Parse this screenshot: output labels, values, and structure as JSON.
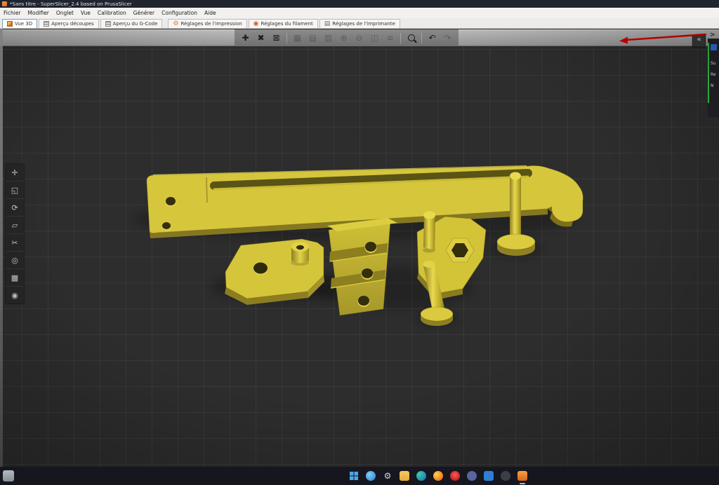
{
  "window": {
    "title": "*Sans titre - SuperSlicer_2.4 based on PrusaSlicer"
  },
  "menubar": {
    "items": [
      "Fichier",
      "Modifier",
      "Onglet",
      "Vue",
      "Calibration",
      "Générer",
      "Configuration",
      "Aide"
    ]
  },
  "tabbar": {
    "tabs": [
      {
        "label": "Vue 3D",
        "icon": "cube-icon",
        "active": true
      },
      {
        "label": "Aperçu découpes",
        "icon": "slices-icon",
        "active": false
      },
      {
        "label": "Aperçu du G-Code",
        "icon": "gcode-icon",
        "active": false
      },
      {
        "label": "Réglages de l'impression",
        "icon": "gear-icon",
        "glyph": "⚙",
        "active": false
      },
      {
        "label": "Réglages du filament",
        "icon": "filament-spool-icon",
        "glyph": "◉",
        "active": false
      },
      {
        "label": "Réglages de l'imprimante",
        "icon": "printer-icon",
        "glyph": "▤",
        "active": false
      }
    ]
  },
  "toolbar": {
    "items": [
      {
        "name": "add-object",
        "glyph": "✚",
        "enabled": true
      },
      {
        "name": "delete-object",
        "glyph": "✖",
        "enabled": true
      },
      {
        "name": "delete-all",
        "glyph": "⊠",
        "enabled": true
      },
      {
        "name": "arrange",
        "glyph": "▦",
        "enabled": false
      },
      {
        "name": "copy",
        "glyph": "▤",
        "enabled": false
      },
      {
        "name": "paste",
        "glyph": "▥",
        "enabled": false
      },
      {
        "name": "add-instance",
        "glyph": "⊕",
        "enabled": false
      },
      {
        "name": "remove-instance",
        "glyph": "⊖",
        "enabled": false
      },
      {
        "name": "split-to-objects",
        "glyph": "◫",
        "enabled": false
      },
      {
        "name": "variable-layer-height",
        "glyph": "≡",
        "enabled": false
      },
      {
        "name": "search",
        "glyph": "",
        "enabled": true
      },
      {
        "name": "undo",
        "glyph": "↶",
        "enabled": true
      },
      {
        "name": "redo",
        "glyph": "↷",
        "enabled": false
      }
    ]
  },
  "gizmo_toolbar": {
    "items": [
      {
        "name": "move",
        "glyph": "✛"
      },
      {
        "name": "scale",
        "glyph": "◱"
      },
      {
        "name": "rotate",
        "glyph": "⟳"
      },
      {
        "name": "place-on-face",
        "glyph": "▱"
      },
      {
        "name": "cut",
        "glyph": "✂"
      },
      {
        "name": "hollow-drill",
        "glyph": "◎"
      },
      {
        "name": "paint-supports",
        "glyph": "▩"
      },
      {
        "name": "seam",
        "glyph": "◉"
      }
    ]
  },
  "viewport": {
    "collapse_button_glyph": "«",
    "expand_button_glyph": ">",
    "model_color": "#d6c63c",
    "model_shadow_color": "#8f8121",
    "bed_color": "#2d2d2d",
    "grid_line_color": "#3c3c3c",
    "parts": [
      {
        "name": "long-slotted-bar"
      },
      {
        "name": "flat-plate-with-hole"
      },
      {
        "name": "stepped-bracket-three-holes"
      },
      {
        "name": "hex-socket-plate"
      },
      {
        "name": "pin-with-flange-base-right"
      },
      {
        "name": "pin-with-flange-base-center"
      }
    ]
  },
  "right_panel": {
    "fragments": [
      "Su",
      "Re",
      "N"
    ],
    "accent_green": "#35c44b"
  },
  "annotation_arrow": {
    "color": "#d40000"
  },
  "taskbar": {
    "icons": [
      {
        "name": "start"
      },
      {
        "name": "search"
      },
      {
        "name": "settings"
      },
      {
        "name": "file-explorer"
      },
      {
        "name": "edge"
      },
      {
        "name": "firefox"
      },
      {
        "name": "opera"
      },
      {
        "name": "discord"
      },
      {
        "name": "vscode"
      },
      {
        "name": "github-desktop"
      },
      {
        "name": "superslicer",
        "active": true
      }
    ]
  }
}
